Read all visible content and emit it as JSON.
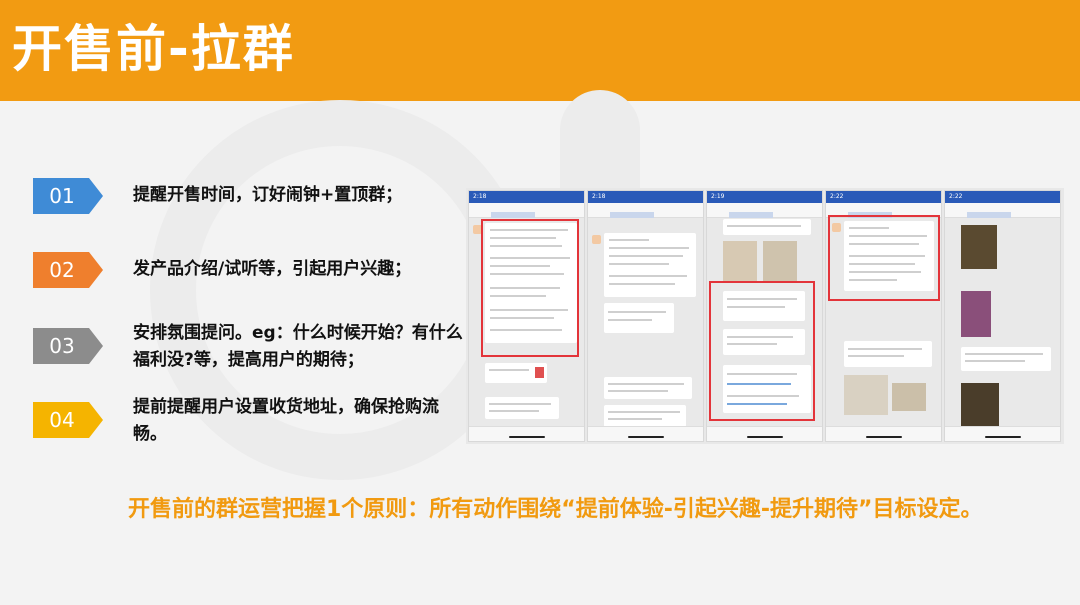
{
  "header": {
    "title": "开售前-拉群"
  },
  "items": [
    {
      "num": "01",
      "text": "提醒开售时间，订好闹钟+置顶群；",
      "color": "#3f8bd6"
    },
    {
      "num": "02",
      "text": "发产品介绍/试听等，引起用户兴趣；",
      "color": "#ef7f2d"
    },
    {
      "num": "03",
      "text": "安排氛围提问。eg：什么时候开始？有什么福利没?等，提高用户的期待；",
      "color": "#8c8c8c"
    },
    {
      "num": "04",
      "text": "提前提醒用户设置收货地址，确保抢购流畅。",
      "color": "#f5b400"
    }
  ],
  "screens": [
    {
      "time": "2:18"
    },
    {
      "time": "2:18"
    },
    {
      "time": "2:19"
    },
    {
      "time": "2:22"
    },
    {
      "time": "2:22"
    }
  ],
  "principle": "开售前的群运营把握1个原则：所有动作围绕“提前体验-引起兴趣-提升期待”目标设定。",
  "colors": {
    "header": "#f29b12",
    "principle": "#f19a10",
    "highlight": "#e3343a"
  }
}
